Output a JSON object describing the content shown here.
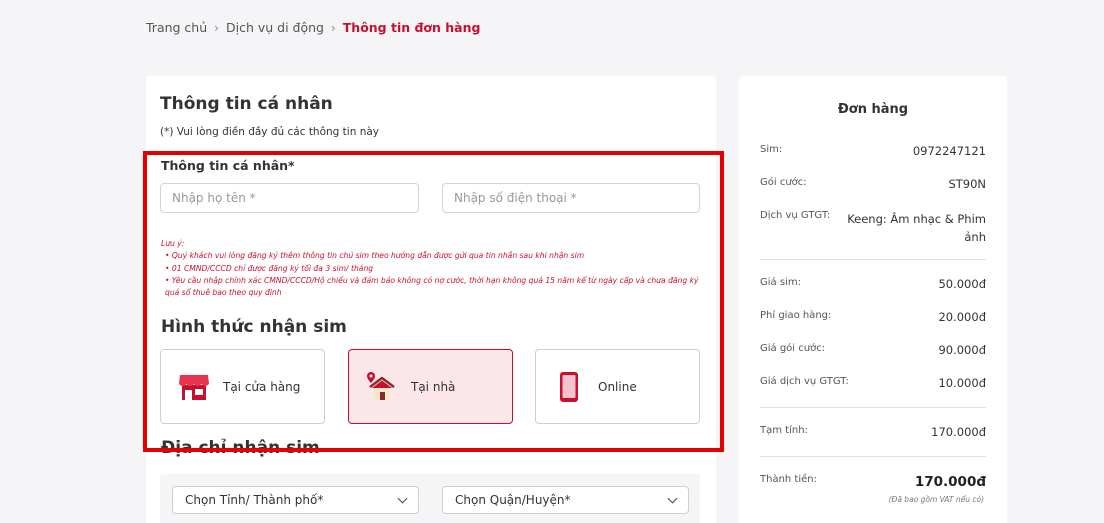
{
  "breadcrumb": {
    "home": "Trang chủ",
    "service": "Dịch vụ di động",
    "current": "Thông tin đơn hàng",
    "separator": "›"
  },
  "form": {
    "title": "Thông tin cá nhân",
    "note": "(*) Vui lòng điền đầy đủ các thông tin này",
    "personal_section": "Thông tin cá nhân*",
    "name_placeholder": "Nhập họ tên *",
    "phone_placeholder": "Nhập số điện thoại *",
    "notes": {
      "heading": "Lưu ý:",
      "lines": [
        "• Quý khách vui lòng đăng ký thêm thông tin chủ sim theo hướng dẫn được gửi qua tin nhắn sau khi nhận sim",
        "• 01 CMND/CCCD chỉ được đăng ký tối đa 3 sim/ tháng",
        "• Yêu cầu nhập chính xác CMND/CCCD/Hộ chiếu và đảm bảo không có nợ cước, thời hạn không quá 15 năm kể từ ngày cấp và chưa đăng ký quá số thuê bao theo quy định"
      ]
    },
    "receive_title": "Hình thức nhận sim",
    "options": [
      {
        "label": "Tại cửa hàng",
        "icon": "store-icon"
      },
      {
        "label": "Tại nhà",
        "icon": "home-pin-icon",
        "selected": true
      },
      {
        "label": "Online",
        "icon": "phone-icon"
      }
    ],
    "address_title": "Địa chỉ nhận sim",
    "province_select": "Chọn Tỉnh/ Thành phố*",
    "district_select": "Chọn Quận/Huyện*"
  },
  "order": {
    "title": "Đơn hàng",
    "sim_label": "Sim:",
    "sim_value": "0972247121",
    "plan_label": "Gói cước:",
    "plan_value": "ST90N",
    "vas_label": "Dịch vụ GTGT:",
    "vas_value_line1": "Keeng: Âm nhạc & Phim",
    "vas_value_line2": "ảnh",
    "sim_price_label": "Giá sim:",
    "sim_price_value": "50.000đ",
    "shipping_label": "Phí giao hàng:",
    "shipping_value": "20.000đ",
    "plan_price_label": "Giá gói cước:",
    "plan_price_value": "90.000đ",
    "vas_price_label": "Giá dịch vụ GTGT:",
    "vas_price_value": "10.000đ",
    "subtotal_label": "Tạm tính:",
    "subtotal_value": "170.000đ",
    "total_label": "Thành tiền:",
    "total_value": "170.000đ",
    "vat_note": "(Đã bao gồm VAT nếu có)"
  },
  "colors": {
    "brand": "#c8102e",
    "highlight": "#e30000",
    "selected_bg": "#fbe6ea"
  }
}
